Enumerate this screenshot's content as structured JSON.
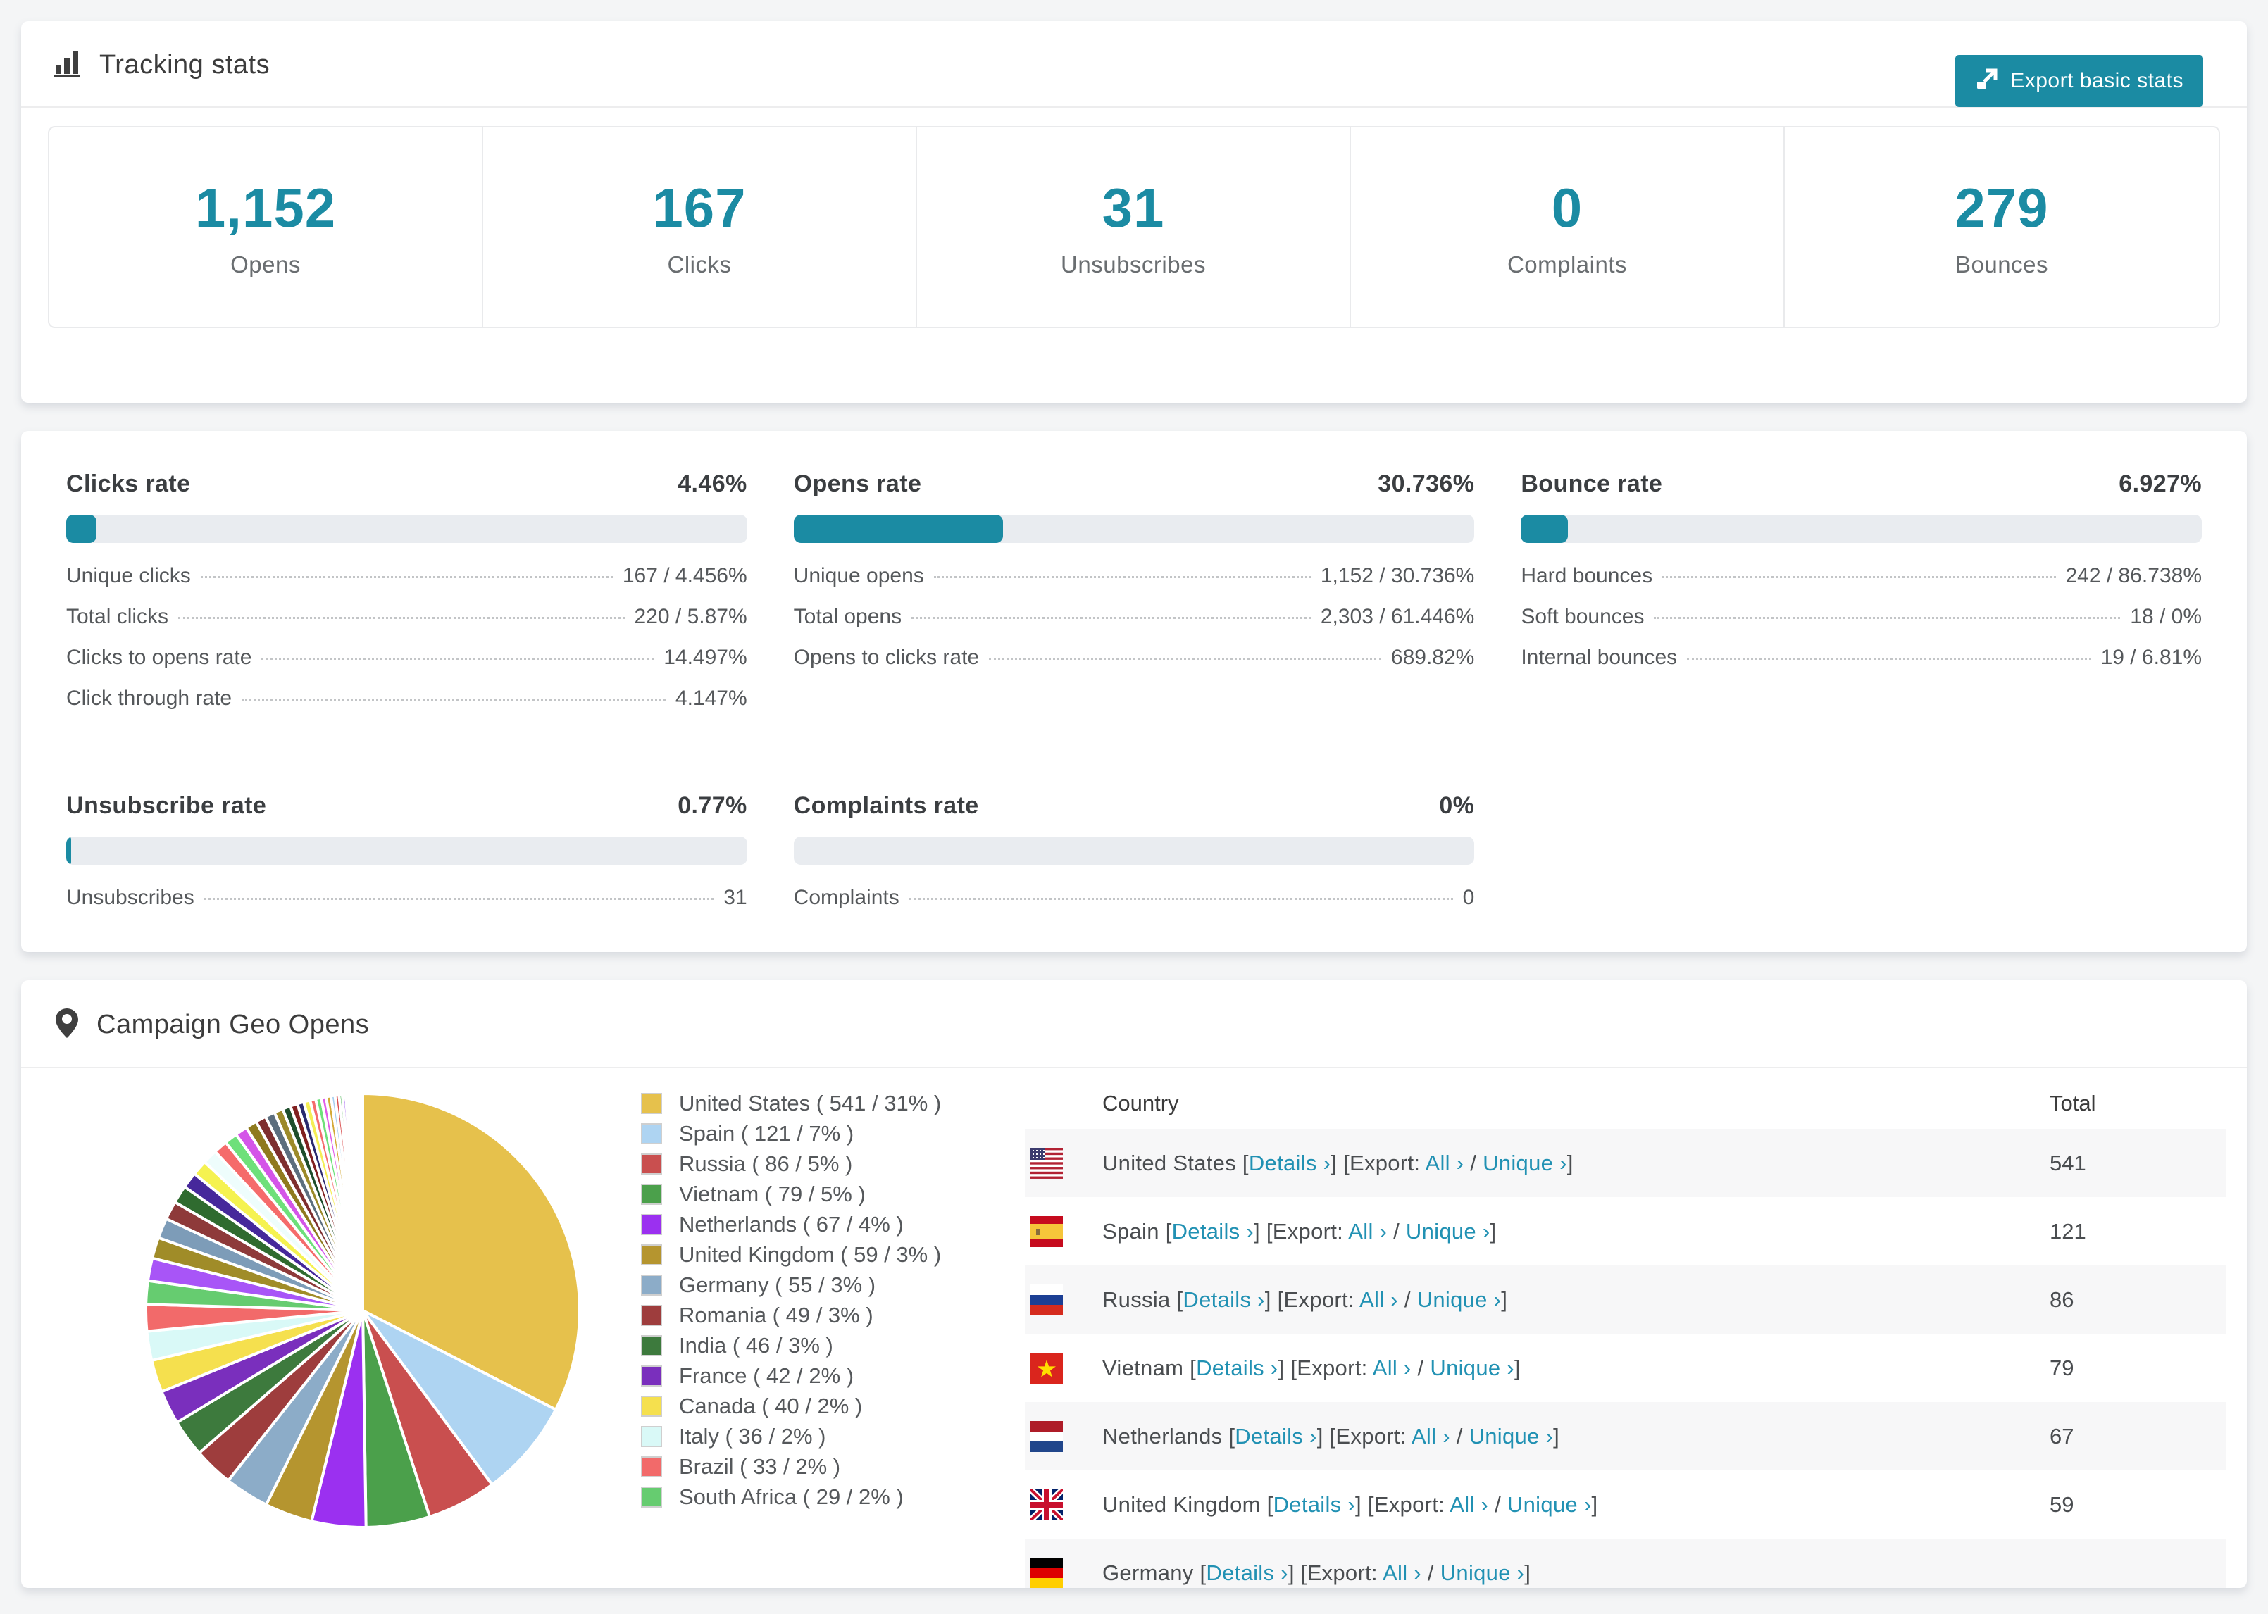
{
  "colors": {
    "teal": "#1b8ba3",
    "link": "#2191b3",
    "bar_track": "#e9ecf0",
    "row_alt_bg": "#f7f7f8"
  },
  "tracking": {
    "title": "Tracking stats",
    "export_button": "Export basic stats",
    "stats": [
      {
        "value": "1,152",
        "label": "Opens"
      },
      {
        "value": "167",
        "label": "Clicks"
      },
      {
        "value": "31",
        "label": "Unsubscribes"
      },
      {
        "value": "0",
        "label": "Complaints"
      },
      {
        "value": "279",
        "label": "Bounces"
      }
    ]
  },
  "rates": {
    "blocks": [
      {
        "title": "Clicks rate",
        "value": "4.46%",
        "pct": 4.46,
        "rows": [
          {
            "label": "Unique clicks",
            "value": "167 / 4.456%"
          },
          {
            "label": "Total clicks",
            "value": "220 / 5.87%"
          },
          {
            "label": "Clicks to opens rate",
            "value": "14.497%"
          },
          {
            "label": "Click through rate",
            "value": "4.147%"
          }
        ]
      },
      {
        "title": "Opens rate",
        "value": "30.736%",
        "pct": 30.736,
        "rows": [
          {
            "label": "Unique opens",
            "value": "1,152 / 30.736%"
          },
          {
            "label": "Total opens",
            "value": "2,303 / 61.446%"
          },
          {
            "label": "Opens to clicks rate",
            "value": "689.82%"
          }
        ]
      },
      {
        "title": "Bounce rate",
        "value": "6.927%",
        "pct": 6.927,
        "rows": [
          {
            "label": "Hard bounces",
            "value": "242 / 86.738%"
          },
          {
            "label": "Soft bounces",
            "value": "18 / 0%"
          },
          {
            "label": "Internal bounces",
            "value": "19 / 6.81%"
          }
        ]
      },
      {
        "title": "Unsubscribe rate",
        "value": "0.77%",
        "pct": 0.77,
        "rows": [
          {
            "label": "Unsubscribes",
            "value": "31"
          }
        ]
      },
      {
        "title": "Complaints rate",
        "value": "0%",
        "pct": 0,
        "rows": [
          {
            "label": "Complaints",
            "value": "0"
          }
        ]
      }
    ]
  },
  "geo": {
    "title": "Campaign Geo Opens",
    "legend": [
      {
        "label": "United States ( 541 / 31% )",
        "color": "#e6c14c"
      },
      {
        "label": "Spain ( 121 / 7% )",
        "color": "#aed4f2"
      },
      {
        "label": "Russia ( 86 / 5% )",
        "color": "#c94f4f"
      },
      {
        "label": "Vietnam ( 79 / 5% )",
        "color": "#4ba04b"
      },
      {
        "label": "Netherlands ( 67 / 4% )",
        "color": "#9b30f0"
      },
      {
        "label": "United Kingdom ( 59 / 3% )",
        "color": "#b5952f"
      },
      {
        "label": "Germany ( 55 / 3% )",
        "color": "#8cacc8"
      },
      {
        "label": "Romania ( 49 / 3% )",
        "color": "#9e3d3d"
      },
      {
        "label": "India ( 46 / 3% )",
        "color": "#3d7a3d"
      },
      {
        "label": "France ( 42 / 2% )",
        "color": "#7a2fbd"
      },
      {
        "label": "Canada ( 40 / 2% )",
        "color": "#f5e04e"
      },
      {
        "label": "Italy ( 36 / 2% )",
        "color": "#d9f9f7"
      },
      {
        "label": "Brazil ( 33 / 2% )",
        "color": "#f26a6a"
      },
      {
        "label": "South Africa ( 29 / 2% )",
        "color": "#66cc70"
      }
    ],
    "table": {
      "country_header": "Country",
      "total_header": "Total",
      "bracket1": " [",
      "bracket2": "] [Export: ",
      "slash": " / ",
      "bracket3": "]",
      "details_link": "Details ›",
      "all_link": "All ›",
      "unique_link": "Unique ›",
      "rows": [
        {
          "country": "United States",
          "flag": "us",
          "total": "541",
          "partial": false
        },
        {
          "country": "Spain",
          "flag": "es",
          "total": "121",
          "partial": false
        },
        {
          "country": "Russia",
          "flag": "ru",
          "total": "86",
          "partial": false
        },
        {
          "country": "Vietnam",
          "flag": "vn",
          "total": "79",
          "partial": false
        },
        {
          "country": "Netherlands",
          "flag": "nl",
          "total": "67",
          "partial": false
        },
        {
          "country": "United Kingdom",
          "flag": "gb",
          "total": "59",
          "partial": false
        },
        {
          "country": "Germany",
          "flag": "de",
          "total": "",
          "partial": true
        }
      ]
    }
  },
  "chart_data": {
    "type": "pie",
    "title": "Campaign Geo Opens",
    "legend_position": "right",
    "start_angle_deg": -90,
    "direction": "clockwise",
    "series": [
      {
        "name": "United States",
        "value": 541,
        "percent": 31,
        "color": "#e6c14c"
      },
      {
        "name": "Spain",
        "value": 121,
        "percent": 7,
        "color": "#aed4f2"
      },
      {
        "name": "Russia",
        "value": 86,
        "percent": 5,
        "color": "#c94f4f"
      },
      {
        "name": "Vietnam",
        "value": 79,
        "percent": 5,
        "color": "#4ba04b"
      },
      {
        "name": "Netherlands",
        "value": 67,
        "percent": 4,
        "color": "#9b30f0"
      },
      {
        "name": "United Kingdom",
        "value": 59,
        "percent": 3,
        "color": "#b5952f"
      },
      {
        "name": "Germany",
        "value": 55,
        "percent": 3,
        "color": "#8cacc8"
      },
      {
        "name": "Romania",
        "value": 49,
        "percent": 3,
        "color": "#9e3d3d"
      },
      {
        "name": "India",
        "value": 46,
        "percent": 3,
        "color": "#3d7a3d"
      },
      {
        "name": "France",
        "value": 42,
        "percent": 2,
        "color": "#7a2fbd"
      },
      {
        "name": "Canada",
        "value": 40,
        "percent": 2,
        "color": "#f5e04e"
      },
      {
        "name": "Italy",
        "value": 36,
        "percent": 2,
        "color": "#d9f9f7"
      },
      {
        "name": "Brazil",
        "value": 33,
        "percent": 2,
        "color": "#f26a6a"
      },
      {
        "name": "South Africa",
        "value": 29,
        "percent": 2,
        "color": "#66cc70"
      }
    ],
    "unlabeled_tail_values": [
      28,
      26,
      25,
      23,
      22,
      20,
      19,
      18,
      17,
      16,
      15,
      14,
      13,
      12,
      11,
      10,
      9,
      8,
      8,
      7,
      7,
      6,
      6,
      5,
      5,
      4,
      4,
      3,
      3,
      3,
      2,
      2,
      2,
      2,
      1,
      1,
      1,
      1
    ],
    "unlabeled_tail_palette": [
      "#a855f7",
      "#a08c28",
      "#7d9cb8",
      "#8e3a3a",
      "#2f6b2f",
      "#46289b",
      "#f5f250",
      "#eefdfc",
      "#f56b6b",
      "#6ee07a",
      "#d455e8",
      "#8f7a1e",
      "#7e2e2e",
      "#5c6e7e",
      "#9c8a2a",
      "#1e4d2b",
      "#802020",
      "#2a2a6e",
      "#f5ee55",
      "#f56b6b",
      "#6ee07a",
      "#e05ae8",
      "#d4a937",
      "#a8d0f0",
      "#d94f4f",
      "#3fae49",
      "#8833ee",
      "#caa62f",
      "#79c4f2",
      "#e85555",
      "#57c257",
      "#b86ef0",
      "#ccaa33",
      "#99ccee",
      "#dd4444",
      "#44aa55",
      "#7744cc",
      "#bb9922"
    ]
  }
}
